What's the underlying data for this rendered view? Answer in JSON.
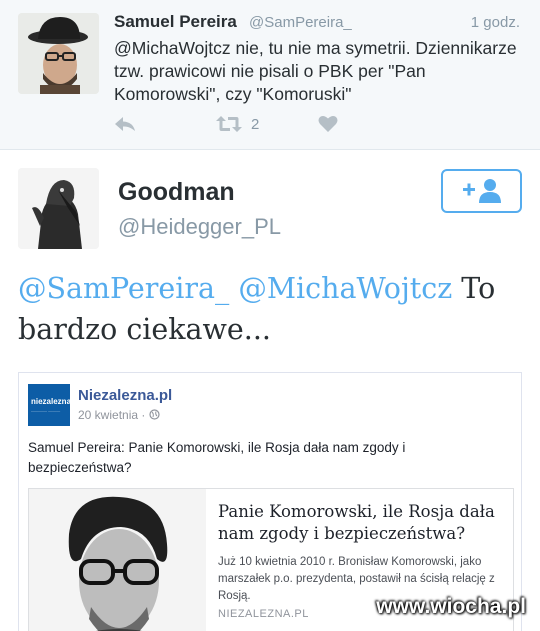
{
  "reply_tweet": {
    "author_name": "Samuel Pereira",
    "author_handle": "@SamPereira_",
    "time": "1 godz.",
    "text": "@MichaWojtcz nie, tu nie ma symetrii. Dziennikarze tzw. prawicowi nie pisali o PBK per \"Pan Komorowski\", czy \"Komoruski\"",
    "retweet_count": "2",
    "icons": {
      "reply": "reply-icon",
      "retweet": "retweet-icon",
      "like": "heart-icon"
    }
  },
  "main_tweet": {
    "author_name": "Goodman",
    "author_handle": "@Heidegger_PL",
    "follow_icon": "add-user-icon",
    "mention_1": "@SamPereira_",
    "mention_2": "@MichaWojtcz",
    "text": "To bardzo ciekawe...",
    "accent_color": "#55acee"
  },
  "embed": {
    "page_name": "Niezalezna.pl",
    "logo_text": "niezalezna",
    "date": "20 kwietnia · ",
    "post_text": "Samuel Pereira: Panie Komorowski, ile Rosja dała nam zgody i bezpieczeństwa?",
    "link_title": "Panie Komorowski, ile Rosja dała nam zgody i bezpieczeństwa?",
    "link_description": "Już 10 kwietnia 2010 r. Bronisław Komorowski, jako marszałek p.o. prezydenta, postawił na ścisłą relację z Rosją.",
    "link_source": "NIEZALEZNA.PL",
    "brand_color": "#0d5da6"
  },
  "watermark": "www.wiocha.pl"
}
